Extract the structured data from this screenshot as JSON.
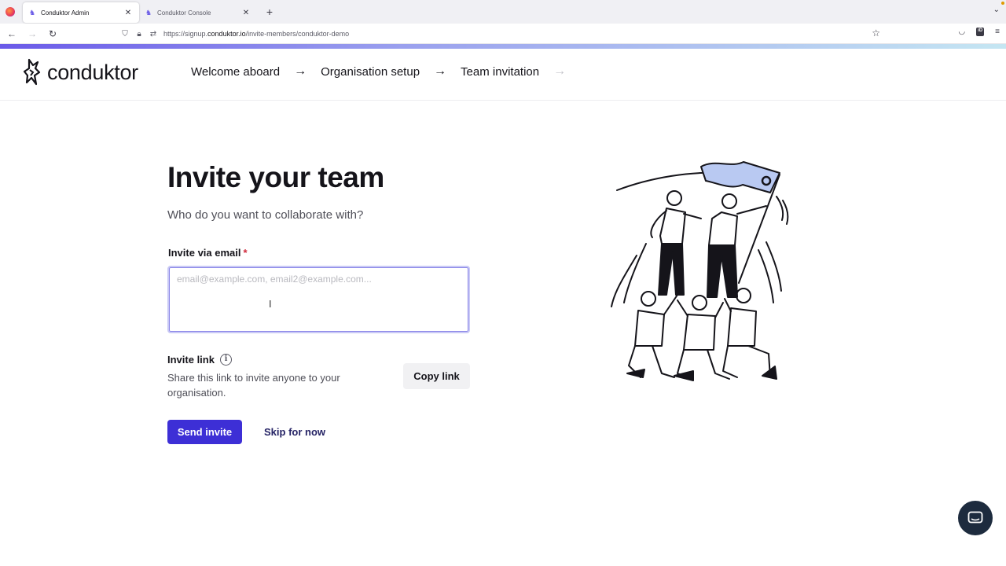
{
  "browser": {
    "tabs": [
      {
        "title": "Conduktor Admin",
        "active": true
      },
      {
        "title": "Conduktor Console",
        "active": false
      }
    ],
    "url_prefix": "https://signup.",
    "url_domain": "conduktor.io",
    "url_path": "/invite-members/conduktor-demo"
  },
  "header": {
    "logo_text": "conduktor",
    "steps": [
      {
        "label": "Welcome aboard"
      },
      {
        "label": "Organisation setup"
      },
      {
        "label": "Team invitation"
      }
    ]
  },
  "main": {
    "title": "Invite your team",
    "subtitle": "Who do you want to collaborate with?",
    "email_label": "Invite via email",
    "required_mark": "*",
    "email_placeholder": "email@example.com, email2@example.com...",
    "email_value": "",
    "invite_link_label": "Invite link",
    "invite_link_desc": "Share this link to invite anyone to your organisation.",
    "copy_link_label": "Copy link",
    "send_invite_label": "Send invite",
    "skip_label": "Skip for now"
  },
  "colors": {
    "primary": "#3d2fd6",
    "focus_border": "#c9c9f5",
    "required": "#d0293b",
    "chat_bg": "#1d2b3e"
  }
}
